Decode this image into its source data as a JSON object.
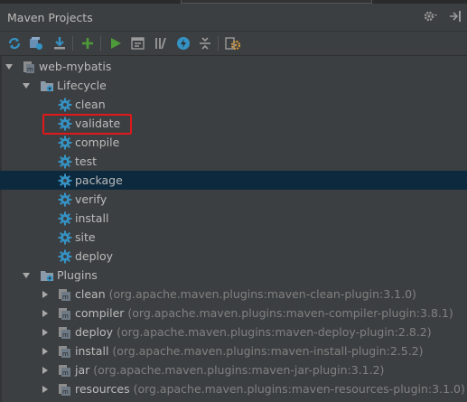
{
  "window": {
    "title": "Maven Projects"
  },
  "toolbar": {
    "buttons": [
      "reimport-icon",
      "generate-sources-icon",
      "download-icon",
      "add-icon",
      "run-icon",
      "execute-goal-icon",
      "toggle-offline-icon",
      "skip-tests-icon",
      "collapse-all-icon",
      "settings-icon"
    ]
  },
  "tree": {
    "project": "web-mybatis",
    "lifecycle": {
      "label": "Lifecycle",
      "phases": [
        "clean",
        "validate",
        "compile",
        "test",
        "package",
        "verify",
        "install",
        "site",
        "deploy"
      ],
      "selected": "package"
    },
    "plugins": {
      "label": "Plugins",
      "items": [
        {
          "name": "clean",
          "hint": "(org.apache.maven.plugins:maven-clean-plugin:3.1.0)"
        },
        {
          "name": "compiler",
          "hint": "(org.apache.maven.plugins:maven-compiler-plugin:3.8.1)"
        },
        {
          "name": "deploy",
          "hint": "(org.apache.maven.plugins:maven-deploy-plugin:2.8.2)"
        },
        {
          "name": "install",
          "hint": "(org.apache.maven.plugins:maven-install-plugin:2.5.2)"
        },
        {
          "name": "jar",
          "hint": "(org.apache.maven.plugins:maven-jar-plugin:3.1.2)"
        },
        {
          "name": "resources",
          "hint": "(org.apache.maven.plugins:maven-resources-plugin:3.1.0)"
        }
      ]
    }
  },
  "colors": {
    "background": "#3c3f41",
    "selection": "#0d293e",
    "highlight": "#e0181b",
    "gear": "#3592c4"
  }
}
